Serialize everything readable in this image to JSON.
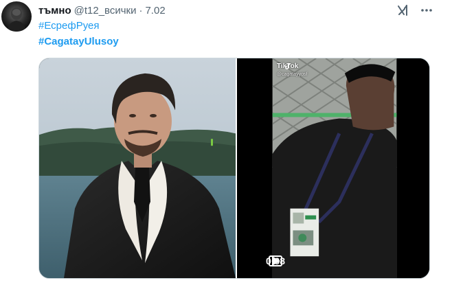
{
  "tweet": {
    "display_name": "тъмно",
    "handle": "@t12_всички",
    "separator": "·",
    "time": "7.02",
    "hashtags": [
      "#ЕсрефРуея",
      "#CagatayUlusoy"
    ]
  },
  "icons": {
    "grok": "grok-icon",
    "more": "more-icon",
    "play": "play-icon",
    "captions": "cc-icon",
    "tiktok": "tiktok-icon"
  },
  "video": {
    "duration": "0:08",
    "tiktok_label": "TikTok",
    "tiktok_user": "@cagatayyosf"
  },
  "colors": {
    "link": "#1d9bf0",
    "secondary_text": "#536471",
    "primary_text": "#0f1419"
  }
}
